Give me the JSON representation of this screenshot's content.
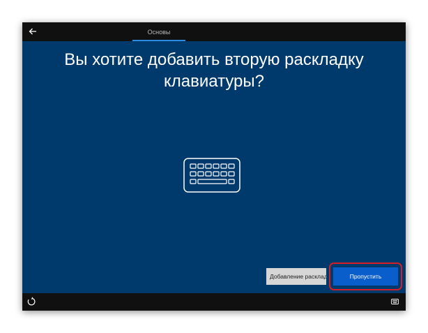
{
  "header": {
    "tab_label": "Основы"
  },
  "main": {
    "title": "Вы хотите добавить вторую раскладку клавиатуры?"
  },
  "buttons": {
    "add_layout_label": "Добавление раскладки",
    "skip_label": "Пропустить"
  },
  "icons": {
    "back": "arrow-left-icon",
    "keyboard": "keyboard-icon",
    "accessibility": "accessibility-icon",
    "input_indicator": "keyboard-icon"
  },
  "colors": {
    "background": "#003a6d",
    "bars": "#101010",
    "primary_button": "#0a5ecb",
    "highlight": "#d41f26"
  }
}
